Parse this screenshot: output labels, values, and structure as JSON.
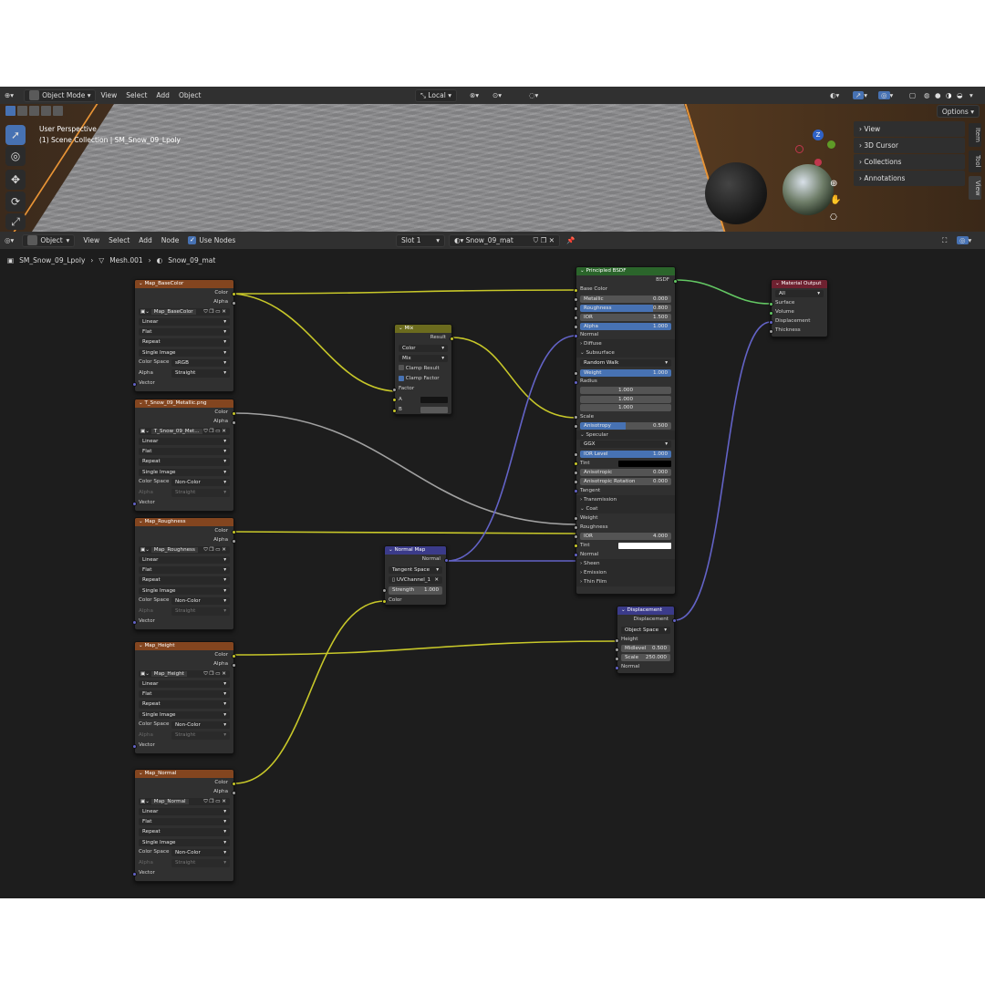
{
  "viewport_header": {
    "editor_icon": "globe-icon",
    "mode": "Object Mode",
    "menus": [
      "View",
      "Select",
      "Add",
      "Object"
    ],
    "transform_orientation": "Local",
    "options": "Options"
  },
  "viewport": {
    "perspective": "User Perspective",
    "collection": "(1) Scene Collection | SM_Snow_09_Lpoly",
    "npanel": [
      "View",
      "3D Cursor",
      "Collections",
      "Annotations"
    ],
    "tabs": [
      "Item",
      "Tool",
      "View"
    ],
    "gizmo_axis": "Z"
  },
  "node_header": {
    "mode": "Object",
    "menus": [
      "View",
      "Select",
      "Add",
      "Node"
    ],
    "use_nodes": "Use Nodes",
    "slot": "Slot 1",
    "material": "Snow_09_mat"
  },
  "breadcrumb": [
    "SM_Snow_09_Lpoly",
    "Mesh.001",
    "Snow_09_mat"
  ],
  "image_nodes": [
    {
      "title": "Map_BaseColor",
      "image": "Map_BaseColor",
      "interp": "Linear",
      "proj": "Flat",
      "ext": "Repeat",
      "src": "Single Image",
      "cs_label": "Color Space",
      "cs": "sRGB",
      "alpha_label": "Alpha",
      "alpha": "Straight",
      "out_color": "Color",
      "out_alpha": "Alpha",
      "in_vector": "Vector"
    },
    {
      "title": "T_Snow_09_Metallic.png",
      "image": "T_Snow_09_Met...",
      "interp": "Linear",
      "proj": "Flat",
      "ext": "Repeat",
      "src": "Single Image",
      "cs_label": "Color Space",
      "cs": "Non-Color",
      "alpha_label": "Alpha",
      "alpha": "Straight",
      "out_color": "Color",
      "out_alpha": "Alpha",
      "in_vector": "Vector"
    },
    {
      "title": "Map_Roughness",
      "image": "Map_Roughness",
      "interp": "Linear",
      "proj": "Flat",
      "ext": "Repeat",
      "src": "Single Image",
      "cs_label": "Color Space",
      "cs": "Non-Color",
      "alpha_label": "Alpha",
      "alpha": "Straight",
      "out_color": "Color",
      "out_alpha": "Alpha",
      "in_vector": "Vector"
    },
    {
      "title": "Map_Height",
      "image": "Map_Height",
      "interp": "Linear",
      "proj": "Flat",
      "ext": "Repeat",
      "src": "Single Image",
      "cs_label": "Color Space",
      "cs": "Non-Color",
      "alpha_label": "Alpha",
      "alpha": "Straight",
      "out_color": "Color",
      "out_alpha": "Alpha",
      "in_vector": "Vector"
    },
    {
      "title": "Map_Normal",
      "image": "Map_Normal",
      "interp": "Linear",
      "proj": "Flat",
      "ext": "Repeat",
      "src": "Single Image",
      "cs_label": "Color Space",
      "cs": "Non-Color",
      "alpha_label": "Alpha",
      "alpha": "Straight",
      "out_color": "Color",
      "out_alpha": "Alpha",
      "in_vector": "Vector"
    }
  ],
  "mix_node": {
    "title": "Mix",
    "result": "Result",
    "data_type": "Color",
    "blend": "Mix",
    "clamp_result": "Clamp Result",
    "clamp_factor": "Clamp Factor",
    "factor": "Factor",
    "a": "A",
    "b": "B"
  },
  "normal_map_node": {
    "title": "Normal Map",
    "out": "Normal",
    "space": "Tangent Space",
    "uv": "UVChannel_1",
    "strength_label": "Strength",
    "strength": "1.000",
    "color": "Color"
  },
  "bsdf_node": {
    "title": "Principled BSDF",
    "out": "BSDF",
    "base_color": "Base Color",
    "metallic": {
      "label": "Metallic",
      "value": "0.000"
    },
    "roughness": {
      "label": "Roughness",
      "value": "0.800",
      "fill": 0.8
    },
    "ior": {
      "label": "IOR",
      "value": "1.500"
    },
    "alpha": {
      "label": "Alpha",
      "value": "1.000",
      "fill": 1.0
    },
    "normal": "Normal",
    "diffuse": "Diffuse",
    "subsurface": "Subsurface",
    "method": "Random Walk",
    "weight": {
      "label": "Weight",
      "value": "1.000",
      "fill": 1.0
    },
    "radius": "Radius",
    "radius_values": [
      "1.000",
      "1.000",
      "1.000"
    ],
    "scale": "Scale",
    "anisotropy": {
      "label": "Anisotropy",
      "value": "0.500",
      "fill": 0.5
    },
    "specular": "Specular",
    "distribution": "GGX",
    "ior_level": {
      "label": "IOR Level",
      "value": "1.000",
      "fill": 1.0
    },
    "tint": "Tint",
    "anisotropic": {
      "label": "Anisotropic",
      "value": "0.000"
    },
    "anisotropic_rotation": {
      "label": "Anisotropic Rotation",
      "value": "0.000"
    },
    "tangent": "Tangent",
    "transmission": "Transmission",
    "coat": "Coat",
    "coat_weight": "Weight",
    "coat_roughness": "Roughness",
    "coat_ior": {
      "label": "IOR",
      "value": "4.000"
    },
    "coat_tint": "Tint",
    "coat_normal": "Normal",
    "sheen": "Sheen",
    "emission": "Emission",
    "thin_film": "Thin Film"
  },
  "output_node": {
    "title": "Material Output",
    "target": "All",
    "surface": "Surface",
    "volume": "Volume",
    "displacement": "Displacement",
    "thickness": "Thickness"
  },
  "displacement_node": {
    "title": "Displacement",
    "out": "Displacement",
    "space": "Object Space",
    "height": "Height",
    "midlevel": {
      "label": "Midlevel",
      "value": "0.500"
    },
    "scale": {
      "label": "Scale",
      "value": "250.000"
    },
    "normal": "Normal"
  },
  "colors": {
    "image_header": "#83451f",
    "mix_header": "#6b6b1e",
    "vector_header": "#3b3b8a",
    "shader_header": "#2b652b",
    "output_header": "#6e2130",
    "accent": "#4772b3",
    "link_color": "#c7c729",
    "link_vector": "#6363c7",
    "link_shader": "#63c763"
  }
}
